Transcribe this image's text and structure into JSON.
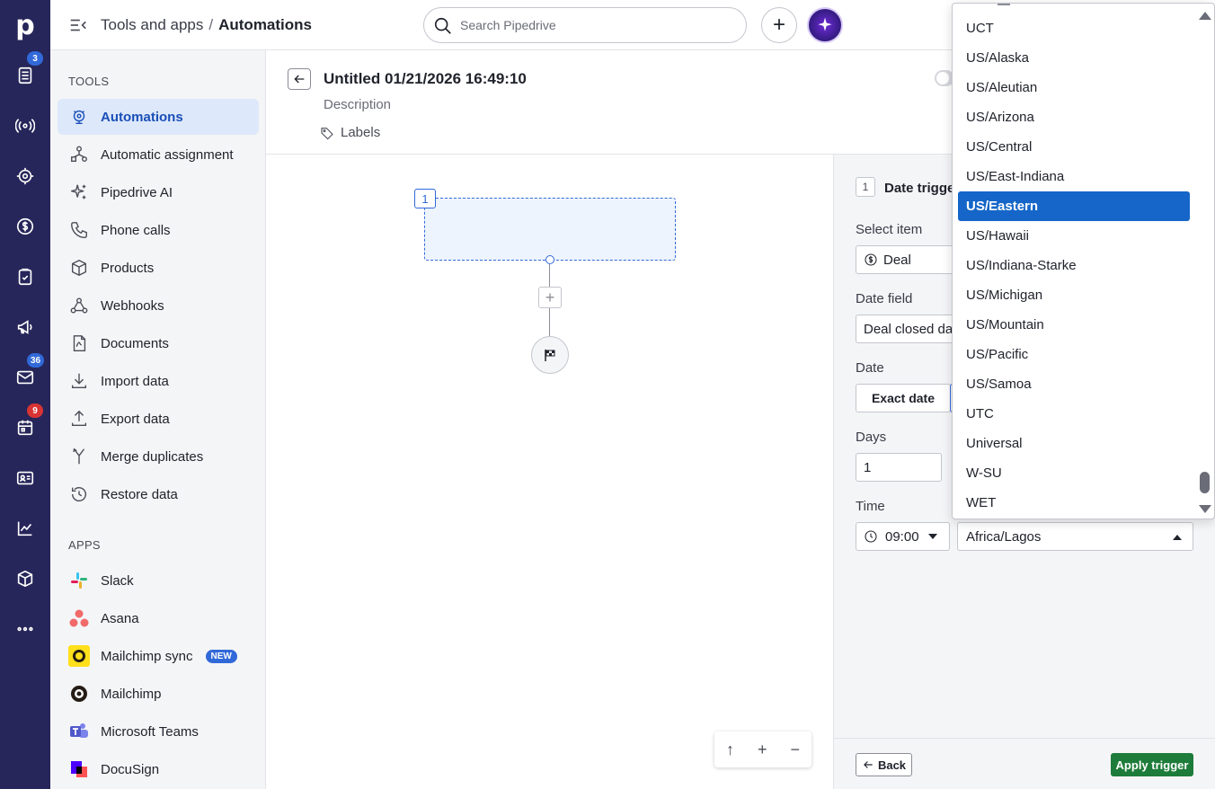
{
  "app": {
    "logo_letter": "p",
    "rail_badges": {
      "leads": "3",
      "mail": "36",
      "calendar": "9"
    }
  },
  "topbar": {
    "breadcrumb_parent": "Tools and apps",
    "breadcrumb_sep": "/",
    "breadcrumb_current": "Automations",
    "search_placeholder": "Search Pipedrive",
    "add_label": "+"
  },
  "sidebar": {
    "tools_title": "TOOLS",
    "tools": [
      {
        "label": "Automations",
        "icon": "automations-icon",
        "active": true
      },
      {
        "label": "Automatic assignment",
        "icon": "assignment-icon"
      },
      {
        "label": "Pipedrive AI",
        "icon": "sparkle-icon"
      },
      {
        "label": "Phone calls",
        "icon": "phone-icon"
      },
      {
        "label": "Products",
        "icon": "box-icon"
      },
      {
        "label": "Webhooks",
        "icon": "webhook-icon"
      },
      {
        "label": "Documents",
        "icon": "document-icon"
      },
      {
        "label": "Import data",
        "icon": "download-icon"
      },
      {
        "label": "Export data",
        "icon": "upload-icon"
      },
      {
        "label": "Merge duplicates",
        "icon": "merge-icon"
      },
      {
        "label": "Restore data",
        "icon": "restore-icon"
      }
    ],
    "apps_title": "APPS",
    "apps": [
      {
        "label": "Slack"
      },
      {
        "label": "Asana"
      },
      {
        "label": "Mailchimp sync",
        "badge": "NEW"
      },
      {
        "label": "Mailchimp"
      },
      {
        "label": "Microsoft Teams"
      },
      {
        "label": "DocuSign"
      }
    ]
  },
  "header": {
    "title": "Untitled 01/21/2026 16:49:10",
    "description": "Description",
    "labels": "Labels"
  },
  "canvas": {
    "step_number": "1",
    "plus": "+",
    "zoom": {
      "up": "↑",
      "plus": "+",
      "minus": "−"
    }
  },
  "panel": {
    "step_number": "1",
    "title": "Date trigger",
    "select_item_label": "Select item",
    "select_item_value": "Deal",
    "date_field_label": "Date field",
    "date_field_value": "Deal closed date",
    "date_label": "Date",
    "exact_date": "Exact date",
    "days_label": "Days",
    "days_value": "1",
    "time_label": "Time",
    "time_value": "09:00",
    "timezone_value": "Africa/Lagos",
    "back": "Back",
    "apply": "Apply trigger"
  },
  "timezone_dropdown": {
    "selected": "US/Eastern",
    "options": [
      "UCT",
      "US/Alaska",
      "US/Aleutian",
      "US/Arizona",
      "US/Central",
      "US/East-Indiana",
      "US/Eastern",
      "US/Hawaii",
      "US/Indiana-Starke",
      "US/Michigan",
      "US/Mountain",
      "US/Pacific",
      "US/Samoa",
      "UTC",
      "Universal",
      "W-SU",
      "WET"
    ]
  },
  "colors": {
    "rail_bg": "#26265a",
    "accent_blue": "#3169d9",
    "selected_option": "#1566c8",
    "apply_green": "#1e7c3a"
  }
}
